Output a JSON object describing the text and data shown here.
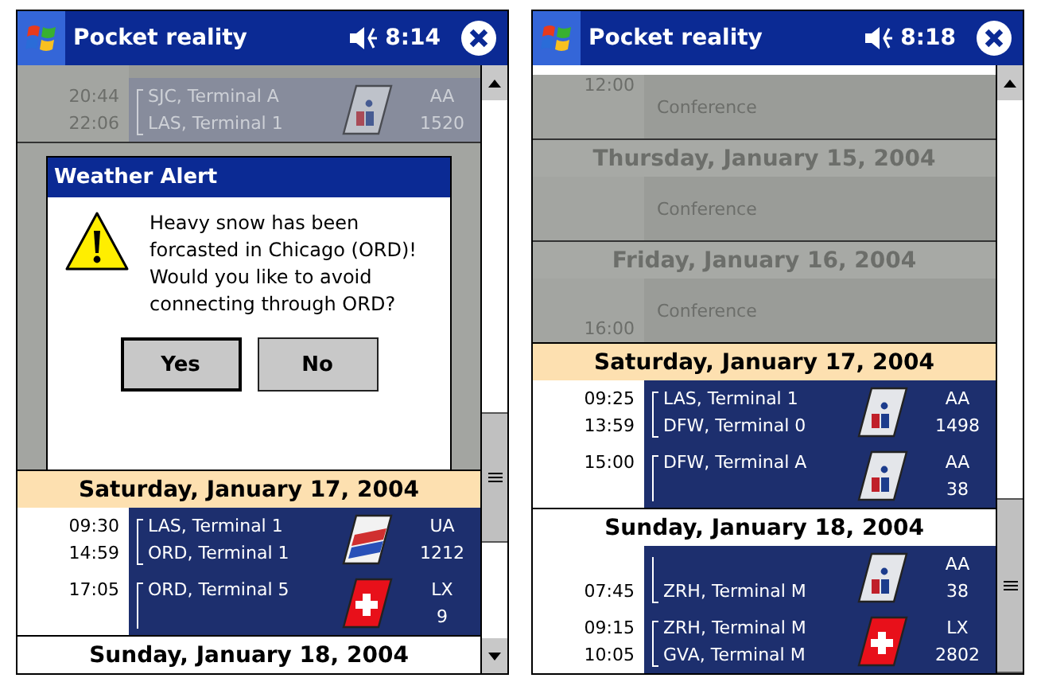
{
  "screens": [
    {
      "title": "Pocket reality",
      "time": "8:14",
      "items": [
        {
          "kind": "event",
          "dimmed": true
        },
        {
          "kind": "flight",
          "dimmed": true,
          "departure": {
            "time": "20:44",
            "place": "SJC, Terminal A"
          },
          "arrival": {
            "time": "22:06",
            "place": "LAS, Terminal 1"
          },
          "airline": "AA",
          "number": "1520",
          "logo": {
            "kind": "aa"
          }
        },
        {
          "kind": "alert",
          "title": "Weather Alert",
          "message": "Heavy snow has been forcasted in Chicago (ORD)! Would you like to avoid connecting through ORD?",
          "buttons": [
            {
              "label": "Yes",
              "default": true
            },
            {
              "label": "No",
              "default": false
            }
          ]
        },
        {
          "kind": "day",
          "label": "Saturday, January 17, 2004",
          "dimmed": false,
          "highlighted": true
        },
        {
          "kind": "flight",
          "dimmed": false,
          "departure": {
            "time": "09:30",
            "place": "LAS, Terminal 1"
          },
          "arrival": {
            "time": "14:59",
            "place": "ORD, Terminal 1"
          },
          "airline": "UA",
          "number": "1212",
          "logo": {
            "kind": "ua"
          }
        },
        {
          "kind": "flight",
          "dimmed": false,
          "departure": {
            "time": "17:05",
            "place": "ORD, Terminal 5"
          },
          "airline": "LX",
          "number": "9",
          "logo": {
            "kind": "lx"
          }
        },
        {
          "kind": "day",
          "label": "Sunday, January 18, 2004",
          "dimmed": false,
          "highlighted": false
        }
      ]
    },
    {
      "title": "Pocket reality",
      "time": "8:18",
      "items": [
        {
          "kind": "event",
          "dimmed": true,
          "start": "12:00",
          "title": "Conference"
        },
        {
          "kind": "day",
          "label": "Thursday, January 15, 2004",
          "dimmed": true,
          "highlighted": false
        },
        {
          "kind": "event",
          "dimmed": true,
          "title": "Conference"
        },
        {
          "kind": "day",
          "label": "Friday, January 16, 2004",
          "dimmed": true,
          "highlighted": false
        },
        {
          "kind": "event",
          "dimmed": true,
          "end": "16:00",
          "title": "Conference"
        },
        {
          "kind": "day",
          "label": "Saturday, January 17, 2004",
          "dimmed": false,
          "highlighted": true
        },
        {
          "kind": "flight",
          "dimmed": false,
          "departure": {
            "time": "09:25",
            "place": "LAS, Terminal 1"
          },
          "arrival": {
            "time": "13:59",
            "place": "DFW, Terminal 0"
          },
          "airline": "AA",
          "number": "1498",
          "logo": {
            "kind": "aa"
          }
        },
        {
          "kind": "flight",
          "dimmed": false,
          "departure": {
            "time": "15:00",
            "place": "DFW, Terminal A"
          },
          "airline": "AA",
          "number": "38",
          "logo": {
            "kind": "aa"
          }
        },
        {
          "kind": "day",
          "label": "Sunday, January 18, 2004",
          "dimmed": false,
          "highlighted": false
        },
        {
          "kind": "flight",
          "dimmed": false,
          "arrival": {
            "time": "07:45",
            "place": "ZRH, Terminal M"
          },
          "airline": "AA",
          "number": "38",
          "logo": {
            "kind": "aa"
          }
        },
        {
          "kind": "flight",
          "dimmed": false,
          "departure": {
            "time": "09:15",
            "place": "ZRH, Terminal M"
          },
          "arrival": {
            "time": "10:05",
            "place": "GVA, Terminal M"
          },
          "airline": "LX",
          "number": "2802",
          "logo": {
            "kind": "lx"
          }
        }
      ]
    }
  ]
}
